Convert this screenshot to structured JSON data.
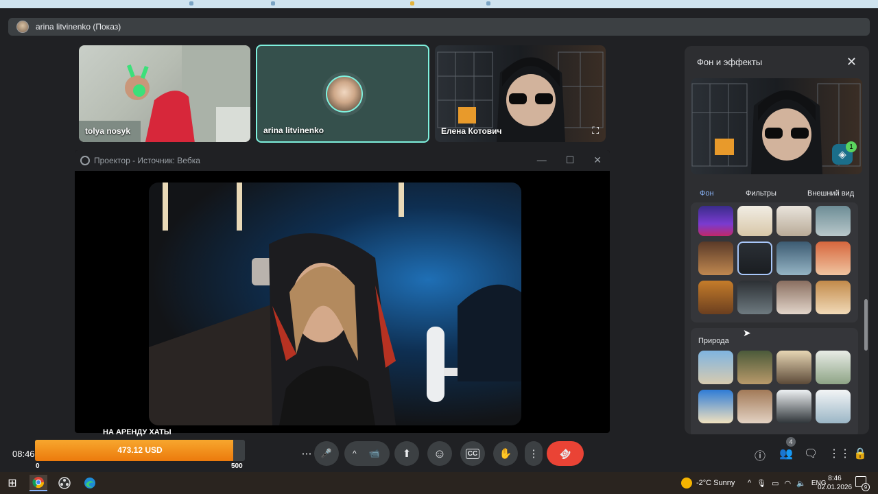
{
  "share_bar": {
    "presenter": "arina litvinenko (Показ)"
  },
  "tiles": [
    {
      "name": "tolya nosyk"
    },
    {
      "name": "arina litvinenko"
    },
    {
      "name": "Елена Котович"
    }
  ],
  "obs_window": {
    "title": "Проектор - Источник: Вебка",
    "minimize": "—",
    "maximize": "☐",
    "close": "✕"
  },
  "effects_panel": {
    "title": "Фон и эффекты",
    "close": "✕",
    "badge_count": "1",
    "tabs": [
      "Фон",
      "Фильтры",
      "Внешний вид"
    ],
    "active_tab": "Фон",
    "nature_section_label": "Природа"
  },
  "donation_goal": {
    "title": "НА АРЕНДУ ХАТЫ",
    "current_text": "473.12 USD",
    "progress": 0.946,
    "min": "0",
    "max": "500"
  },
  "clock_overlay": "08:46",
  "controls": {
    "more": "⋯",
    "mic": "🎤",
    "mic_chevron": "^",
    "camera": "📹",
    "present": "⬆",
    "emoji": "☺",
    "captions": "CC",
    "raise_hand": "✋",
    "options": "⋮",
    "end_call": "☎"
  },
  "right_controls": {
    "people_count": "4"
  },
  "taskbar": {
    "weather": "-2°C  Sunny",
    "lang": "ENG",
    "time": "8:46",
    "date": "02.01.2026",
    "notifications": "9"
  },
  "colors": {
    "active_tile_border": "#7ff1de",
    "goal_fill": "#ec7a0c",
    "end_call": "#ea4335",
    "active_tab": "#8ab4f8"
  }
}
